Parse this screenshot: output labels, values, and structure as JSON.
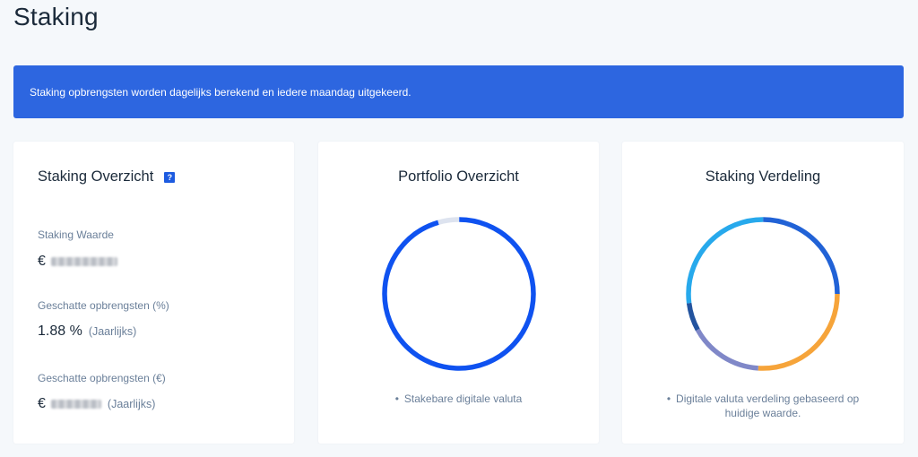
{
  "page": {
    "title": "Staking"
  },
  "banner": {
    "text": "Staking opbrengsten worden dagelijks berekend en iedere maandag uitgekeerd."
  },
  "overview_card": {
    "title": "Staking Overzicht",
    "help_icon": "?",
    "staking_value_label": "Staking Waarde",
    "staking_value_currency": "€",
    "expected_pct_label": "Geschatte opbrengsten (%)",
    "expected_pct_value": "1.88 %",
    "expected_pct_suffix": "(Jaarlijks)",
    "expected_eur_label": "Geschatte opbrengsten (€)",
    "expected_eur_currency": "€",
    "expected_eur_suffix": "(Jaarlijks)"
  },
  "portfolio_card": {
    "title": "Portfolio Overzicht",
    "legend": "Stakebare digitale valuta",
    "segments": [
      {
        "share": 0.955,
        "color": "#0f52f0"
      },
      {
        "share": 0.045,
        "color": "#dde3ef"
      }
    ]
  },
  "distribution_card": {
    "title": "Staking Verdeling",
    "legend_line1": "Digitale valuta verdeling gebaseerd op",
    "legend_line2": "huidige waarde.",
    "segments": [
      {
        "share": 0.25,
        "color": "#2162d6"
      },
      {
        "share": 0.26,
        "color": "#f6a43a"
      },
      {
        "share": 0.16,
        "color": "#8088c8"
      },
      {
        "share": 0.06,
        "color": "#23539e"
      },
      {
        "share": 0.27,
        "color": "#27a9ec"
      }
    ]
  }
}
